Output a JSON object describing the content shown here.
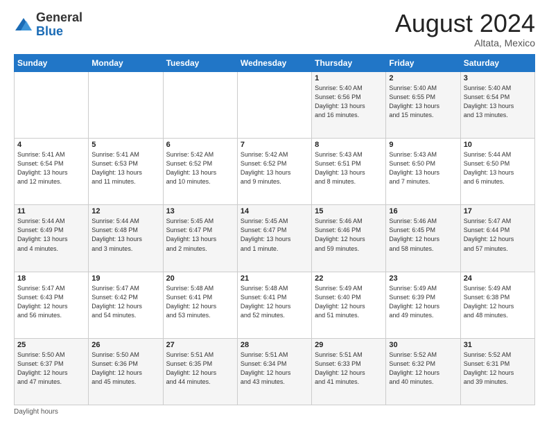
{
  "header": {
    "logo_general": "General",
    "logo_blue": "Blue",
    "month_title": "August 2024",
    "location": "Altata, Mexico"
  },
  "footer": {
    "daylight_label": "Daylight hours"
  },
  "days_of_week": [
    "Sunday",
    "Monday",
    "Tuesday",
    "Wednesday",
    "Thursday",
    "Friday",
    "Saturday"
  ],
  "weeks": [
    [
      {
        "day": "",
        "info": ""
      },
      {
        "day": "",
        "info": ""
      },
      {
        "day": "",
        "info": ""
      },
      {
        "day": "",
        "info": ""
      },
      {
        "day": "1",
        "info": "Sunrise: 5:40 AM\nSunset: 6:56 PM\nDaylight: 13 hours\nand 16 minutes."
      },
      {
        "day": "2",
        "info": "Sunrise: 5:40 AM\nSunset: 6:55 PM\nDaylight: 13 hours\nand 15 minutes."
      },
      {
        "day": "3",
        "info": "Sunrise: 5:40 AM\nSunset: 6:54 PM\nDaylight: 13 hours\nand 13 minutes."
      }
    ],
    [
      {
        "day": "4",
        "info": "Sunrise: 5:41 AM\nSunset: 6:54 PM\nDaylight: 13 hours\nand 12 minutes."
      },
      {
        "day": "5",
        "info": "Sunrise: 5:41 AM\nSunset: 6:53 PM\nDaylight: 13 hours\nand 11 minutes."
      },
      {
        "day": "6",
        "info": "Sunrise: 5:42 AM\nSunset: 6:52 PM\nDaylight: 13 hours\nand 10 minutes."
      },
      {
        "day": "7",
        "info": "Sunrise: 5:42 AM\nSunset: 6:52 PM\nDaylight: 13 hours\nand 9 minutes."
      },
      {
        "day": "8",
        "info": "Sunrise: 5:43 AM\nSunset: 6:51 PM\nDaylight: 13 hours\nand 8 minutes."
      },
      {
        "day": "9",
        "info": "Sunrise: 5:43 AM\nSunset: 6:50 PM\nDaylight: 13 hours\nand 7 minutes."
      },
      {
        "day": "10",
        "info": "Sunrise: 5:44 AM\nSunset: 6:50 PM\nDaylight: 13 hours\nand 6 minutes."
      }
    ],
    [
      {
        "day": "11",
        "info": "Sunrise: 5:44 AM\nSunset: 6:49 PM\nDaylight: 13 hours\nand 4 minutes."
      },
      {
        "day": "12",
        "info": "Sunrise: 5:44 AM\nSunset: 6:48 PM\nDaylight: 13 hours\nand 3 minutes."
      },
      {
        "day": "13",
        "info": "Sunrise: 5:45 AM\nSunset: 6:47 PM\nDaylight: 13 hours\nand 2 minutes."
      },
      {
        "day": "14",
        "info": "Sunrise: 5:45 AM\nSunset: 6:47 PM\nDaylight: 13 hours\nand 1 minute."
      },
      {
        "day": "15",
        "info": "Sunrise: 5:46 AM\nSunset: 6:46 PM\nDaylight: 12 hours\nand 59 minutes."
      },
      {
        "day": "16",
        "info": "Sunrise: 5:46 AM\nSunset: 6:45 PM\nDaylight: 12 hours\nand 58 minutes."
      },
      {
        "day": "17",
        "info": "Sunrise: 5:47 AM\nSunset: 6:44 PM\nDaylight: 12 hours\nand 57 minutes."
      }
    ],
    [
      {
        "day": "18",
        "info": "Sunrise: 5:47 AM\nSunset: 6:43 PM\nDaylight: 12 hours\nand 56 minutes."
      },
      {
        "day": "19",
        "info": "Sunrise: 5:47 AM\nSunset: 6:42 PM\nDaylight: 12 hours\nand 54 minutes."
      },
      {
        "day": "20",
        "info": "Sunrise: 5:48 AM\nSunset: 6:41 PM\nDaylight: 12 hours\nand 53 minutes."
      },
      {
        "day": "21",
        "info": "Sunrise: 5:48 AM\nSunset: 6:41 PM\nDaylight: 12 hours\nand 52 minutes."
      },
      {
        "day": "22",
        "info": "Sunrise: 5:49 AM\nSunset: 6:40 PM\nDaylight: 12 hours\nand 51 minutes."
      },
      {
        "day": "23",
        "info": "Sunrise: 5:49 AM\nSunset: 6:39 PM\nDaylight: 12 hours\nand 49 minutes."
      },
      {
        "day": "24",
        "info": "Sunrise: 5:49 AM\nSunset: 6:38 PM\nDaylight: 12 hours\nand 48 minutes."
      }
    ],
    [
      {
        "day": "25",
        "info": "Sunrise: 5:50 AM\nSunset: 6:37 PM\nDaylight: 12 hours\nand 47 minutes."
      },
      {
        "day": "26",
        "info": "Sunrise: 5:50 AM\nSunset: 6:36 PM\nDaylight: 12 hours\nand 45 minutes."
      },
      {
        "day": "27",
        "info": "Sunrise: 5:51 AM\nSunset: 6:35 PM\nDaylight: 12 hours\nand 44 minutes."
      },
      {
        "day": "28",
        "info": "Sunrise: 5:51 AM\nSunset: 6:34 PM\nDaylight: 12 hours\nand 43 minutes."
      },
      {
        "day": "29",
        "info": "Sunrise: 5:51 AM\nSunset: 6:33 PM\nDaylight: 12 hours\nand 41 minutes."
      },
      {
        "day": "30",
        "info": "Sunrise: 5:52 AM\nSunset: 6:32 PM\nDaylight: 12 hours\nand 40 minutes."
      },
      {
        "day": "31",
        "info": "Sunrise: 5:52 AM\nSunset: 6:31 PM\nDaylight: 12 hours\nand 39 minutes."
      }
    ]
  ]
}
